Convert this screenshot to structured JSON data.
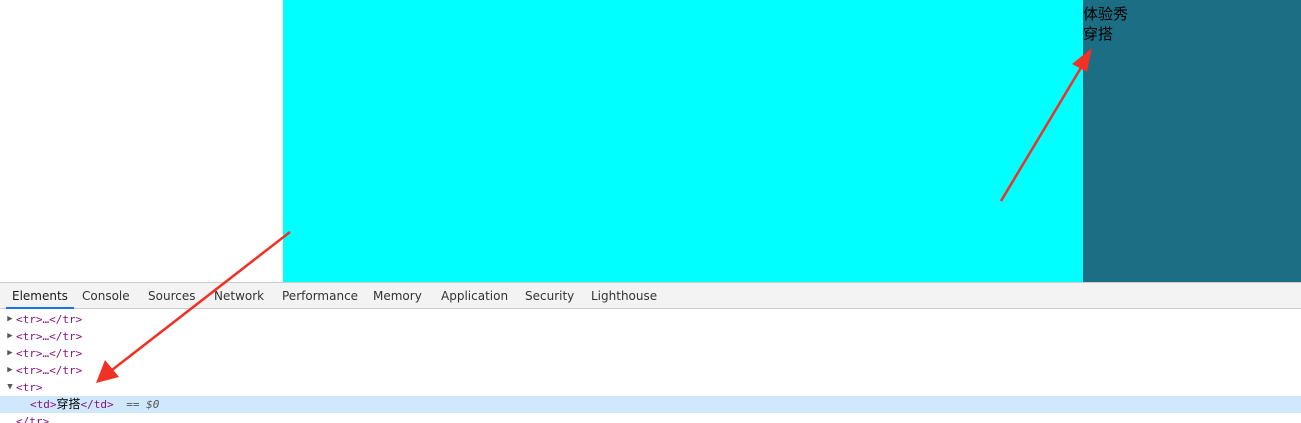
{
  "colors": {
    "cyan": "#00ffff",
    "teal": "#1b6e84",
    "annotation_red": "#f03125"
  },
  "page": {
    "cell_text_line1": "体验秀",
    "cell_text_line2": "穿搭"
  },
  "devtools": {
    "tabs": [
      "Elements",
      "Console",
      "Sources",
      "Network",
      "Performance",
      "Memory",
      "Application",
      "Security",
      "Lighthouse"
    ],
    "active_tab": "Elements",
    "tree": {
      "collapsed_row": "<tr>…</tr>",
      "open_tr": "<tr>",
      "td_open": "<td>",
      "td_text": "穿搭",
      "td_close": "</td>",
      "selected_marker": "== $0",
      "close_tr": "</tr>"
    }
  }
}
